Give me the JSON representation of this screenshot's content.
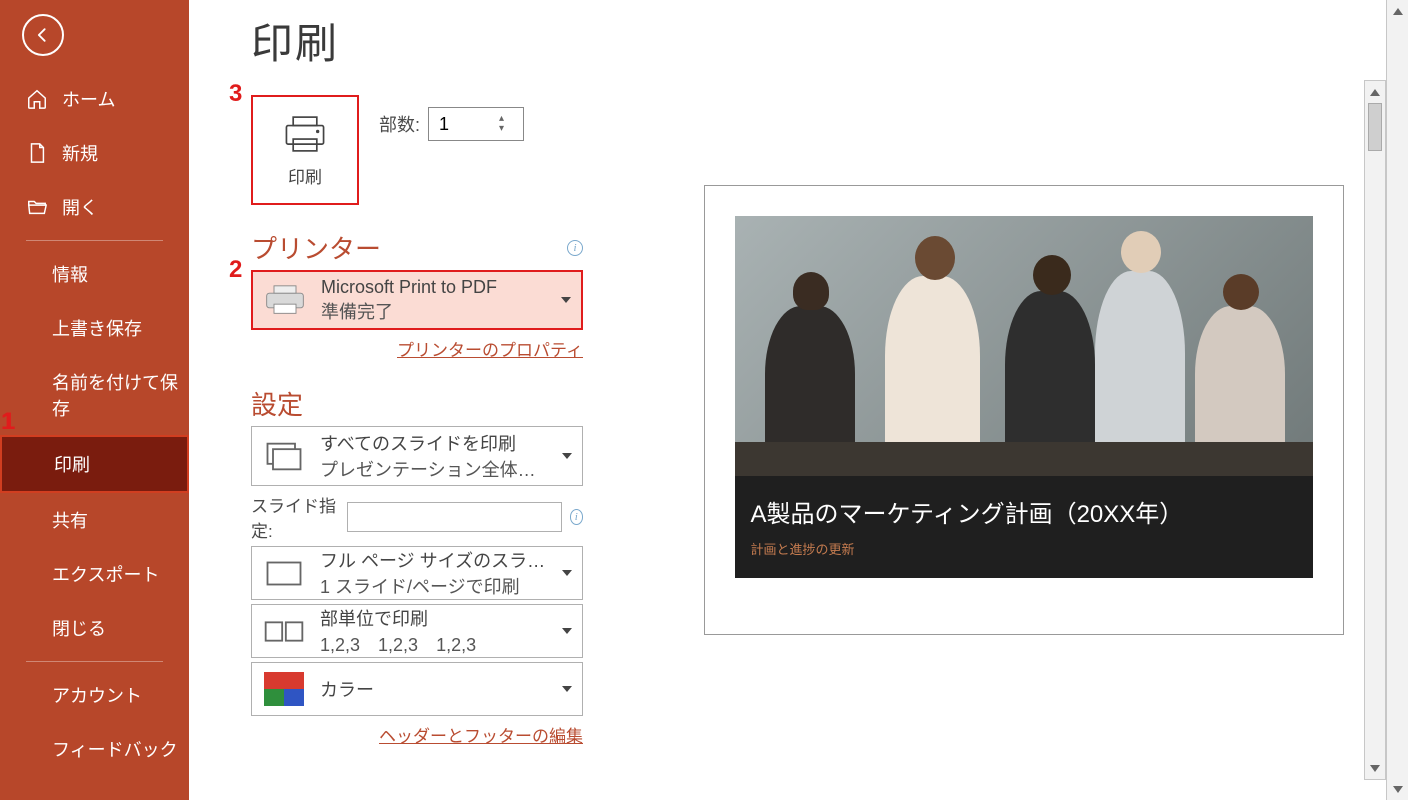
{
  "sidebar": {
    "home": "ホーム",
    "new": "新規",
    "open": "開く",
    "info": "情報",
    "save": "上書き保存",
    "saveas": "名前を付けて保存",
    "print": "印刷",
    "share": "共有",
    "export": "エクスポート",
    "close": "閉じる",
    "account": "アカウント",
    "feedback": "フィードバック"
  },
  "page": {
    "title": "印刷"
  },
  "print_button": {
    "label": "印刷"
  },
  "copies": {
    "label": "部数:",
    "value": "1"
  },
  "printer": {
    "section": "プリンター",
    "name": "Microsoft Print to PDF",
    "status": "準備完了",
    "properties_link": "プリンターのプロパティ"
  },
  "settings": {
    "section": "設定",
    "range": {
      "title": "すべてのスライドを印刷",
      "sub": "プレゼンテーション全体を印刷し…"
    },
    "slide_spec_label": "スライド指定:",
    "layout": {
      "title": "フル ページ サイズのスライド",
      "sub": "1 スライド/ページで印刷"
    },
    "collate": {
      "title": "部単位で印刷",
      "sub": "1,2,3　1,2,3　1,2,3"
    },
    "color": {
      "title": "カラー"
    },
    "header_footer_link": "ヘッダーとフッターの編集"
  },
  "preview": {
    "title": "A製品のマーケティング計画（20XX年）",
    "subtitle": "計画と進捗の更新"
  },
  "annotations": {
    "a1": "1",
    "a2": "2",
    "a3": "3"
  }
}
